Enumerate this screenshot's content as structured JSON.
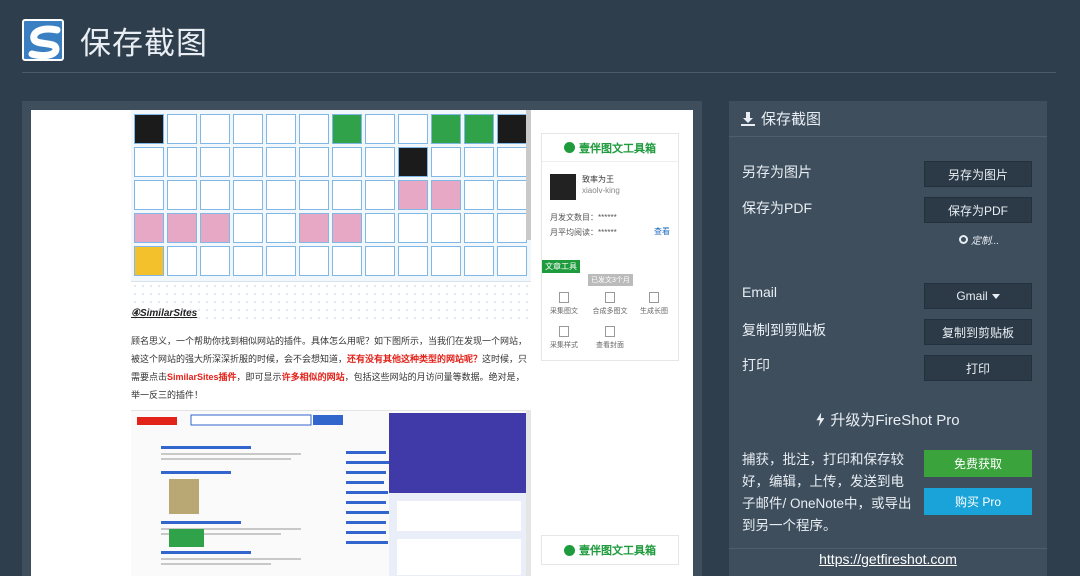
{
  "header": {
    "title": "保存截图"
  },
  "preview": {
    "section_title": "④SimilarSites",
    "paragraph_parts": [
      "顾名思义，一个帮助你找到相似网站的插件。具体怎么用呢？如下图所示，当我们在发现一个网站，被这个网站的强大所深深折服的时候，会不会想知道，",
      "还有没有其他这种类型的网站呢？",
      "这时候，只需要点击",
      "SimilarSites插件",
      "，即可显示",
      "许多相似的网站",
      "，包括这些网站的月访问量等数据。绝对是，举一反三的插件！"
    ],
    "tool": {
      "title": "壹伴图文工具箱",
      "account_name": "致率为王",
      "account_id": "xiaolv-king",
      "monthly_posts_label": "月发文数目：",
      "monthly_posts_value": "******",
      "monthly_reads_label": "月平均阅读：",
      "monthly_reads_value": "******",
      "view_link": "查看",
      "badge": "文章工具",
      "badge_sub": "已发文3个月",
      "actions": [
        "采集图文",
        "合成多图文",
        "生成长图",
        "采集样式",
        "查看封面"
      ]
    },
    "tool2_title": "壹伴图文工具箱"
  },
  "panel": {
    "header": "保存截图",
    "rows": [
      {
        "label": "另存为图片",
        "button": "另存为图片"
      },
      {
        "label": "保存为PDF",
        "button": "保存为PDF"
      },
      {
        "label": "Email",
        "button": "Gmail"
      },
      {
        "label": "复制到剪贴板",
        "button": "复制到剪贴板"
      },
      {
        "label": "打印",
        "button": "打印"
      }
    ],
    "customize": "定制...",
    "upgrade": "升级为FireShot Pro",
    "description": "捕获，批注，打印和保存较好，编辑，上传，发送到电子邮件/ OneNote中，或导出到另一个程序。",
    "free_button": "免费获取",
    "buy_button": "购买 Pro",
    "website": "https://getfireshot.com"
  }
}
